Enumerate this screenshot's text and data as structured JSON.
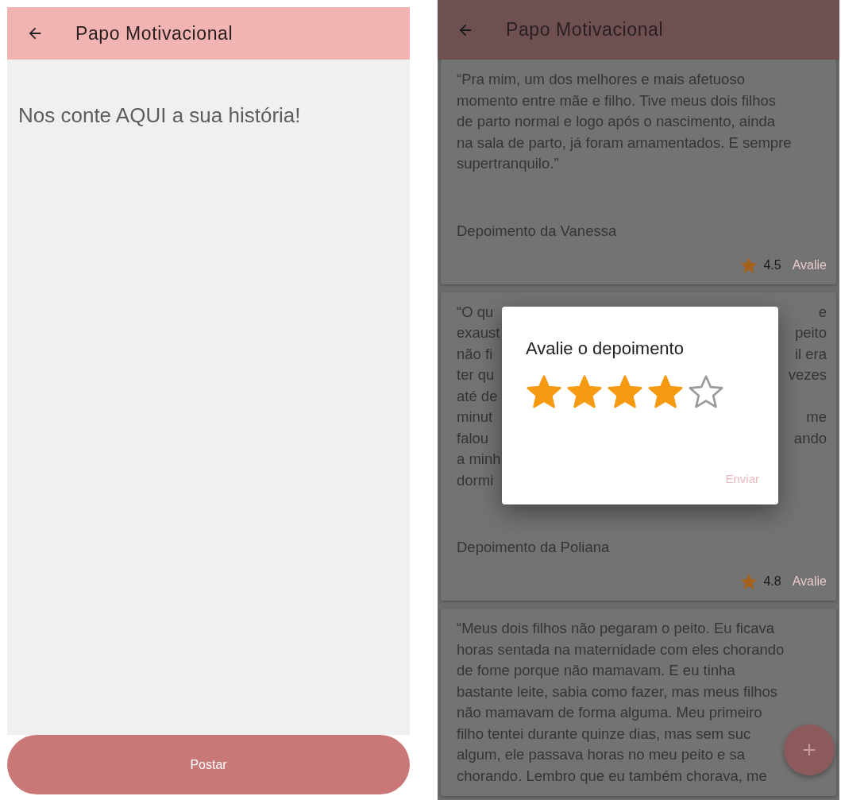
{
  "left_screen": {
    "app_bar": {
      "title": "Papo Motivacional"
    },
    "story_field": {
      "placeholder": "Nos conte AQUI a sua história!"
    },
    "post_button": {
      "label": "Postar",
      "disabled": true
    }
  },
  "right_screen": {
    "app_bar": {
      "title": "Papo Motivacional"
    },
    "testimonials": [
      {
        "kind": "full",
        "quote": "“Pra mim, um dos melhores e mais afetuoso momento entre mãe e filho. Tive meus dois filhos de parto normal e logo após o nascimento, ainda na sala de parto, já foram amamentados. E sempre supertranquilo.”",
        "author": "Depoimento da Vanessa",
        "rating": "4.5",
        "rate_link": "Avalie"
      },
      {
        "kind": "covered",
        "quote_fragments": [
          {
            "left": "“O qu",
            "right": "e"
          },
          {
            "left": "exaust",
            "right": "peito"
          },
          {
            "left": "não fi",
            "right": "il era"
          },
          {
            "left": "ter qu",
            "right": "vezes"
          },
          {
            "left": "até de"
          },
          {
            "left": "minut",
            "right": "me"
          },
          {
            "left": "falou",
            "right": "ando"
          },
          {
            "left": "a minh"
          },
          {
            "left": "dormi"
          }
        ],
        "author": "Depoimento da Poliana",
        "rating": "4.8",
        "rate_link": "Avalie"
      },
      {
        "kind": "lines",
        "quote_lines": [
          "“Meus dois filhos não pegaram o peito. Eu ficava",
          "horas sentada na maternidade com eles chorando",
          "de fome porque não mamavam. E eu tinha",
          "bastante leite, sabia como fazer, mas meus filhos",
          "não mamavam de forma alguma. Meu primeiro",
          "filho tentei durante quinze dias, mas sem suc",
          "algum, ele passava horas no meu peito e sa",
          "chorando. Lembro que eu também chorava, me"
        ]
      }
    ],
    "rating_dialog": {
      "title": "Avalie o depoimento",
      "stars": 4,
      "submit": "Enviar"
    },
    "fab": {
      "label": "+"
    }
  }
}
